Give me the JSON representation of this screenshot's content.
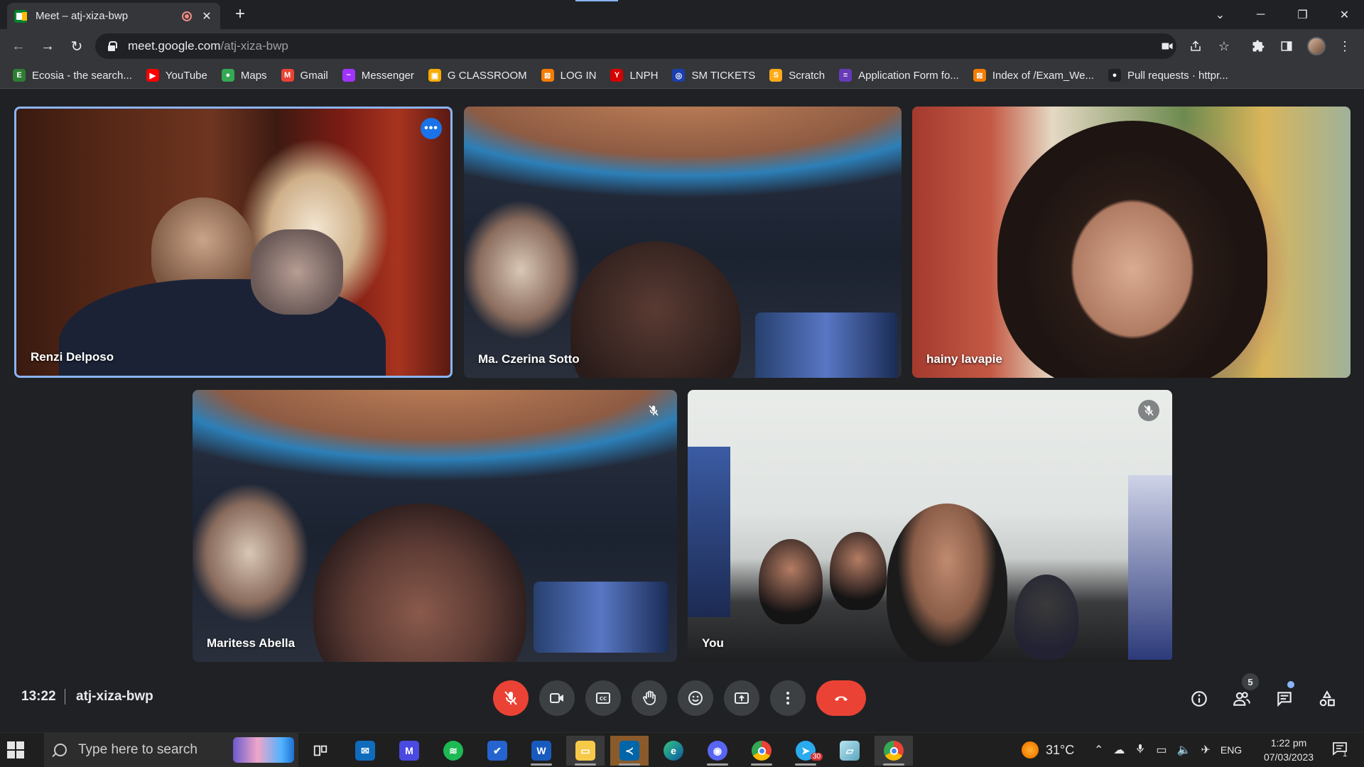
{
  "browser": {
    "tab_title": "Meet – atj-xiza-bwp",
    "url_host": "meet.google.com",
    "url_path": "/atj-xiza-bwp",
    "bookmarks": [
      {
        "label": "Ecosia - the search...",
        "icon": "ecosia-icon",
        "color": "#2e7d32",
        "glyph": "E"
      },
      {
        "label": "YouTube",
        "icon": "youtube-icon",
        "color": "#ff0000",
        "glyph": "▶"
      },
      {
        "label": "Maps",
        "icon": "maps-icon",
        "color": "#34a853",
        "glyph": "●"
      },
      {
        "label": "Gmail",
        "icon": "gmail-icon",
        "color": "#ea4335",
        "glyph": "M"
      },
      {
        "label": "Messenger",
        "icon": "messenger-icon",
        "color": "#a033ff",
        "glyph": "~"
      },
      {
        "label": "G CLASSROOM",
        "icon": "classroom-icon",
        "color": "#f9ab00",
        "glyph": "▣"
      },
      {
        "label": "LOG IN",
        "icon": "login-icon",
        "color": "#f57c00",
        "glyph": "⊠"
      },
      {
        "label": "LNPH",
        "icon": "lnph-icon",
        "color": "#d50000",
        "glyph": "Y"
      },
      {
        "label": "SM TICKETS",
        "icon": "sm-tickets-icon",
        "color": "#1a3fb0",
        "glyph": "◎"
      },
      {
        "label": "Scratch",
        "icon": "scratch-icon",
        "color": "#ffab19",
        "glyph": "S"
      },
      {
        "label": "Application Form fo...",
        "icon": "forms-icon",
        "color": "#673ab7",
        "glyph": "≡"
      },
      {
        "label": "Index of /Exam_We...",
        "icon": "index-icon",
        "color": "#f57c00",
        "glyph": "⊠"
      },
      {
        "label": "Pull requests · httpr...",
        "icon": "github-icon",
        "color": "#202124",
        "glyph": "●"
      }
    ]
  },
  "meet": {
    "participants": [
      {
        "name": "Renzi Delposo",
        "muted": false,
        "pinned_menu": true
      },
      {
        "name": "Ma. Czerina Sotto",
        "muted": false
      },
      {
        "name": "hainy lavapie",
        "muted": false
      },
      {
        "name": "Maritess Abella",
        "muted": true
      },
      {
        "name": "You",
        "muted": true
      }
    ],
    "time": "13:22",
    "meeting_code": "atj-xiza-bwp",
    "people_count": "5",
    "colors": {
      "accent": "#1a73e8",
      "danger": "#ea4335",
      "bar": "#3c4043"
    }
  },
  "taskbar": {
    "search_placeholder": "Type here to search",
    "temperature": "31°C",
    "language": "ENG",
    "time": "1:22 pm",
    "date": "07/03/2023",
    "telegram_badge": "30",
    "notification_count": "1"
  }
}
